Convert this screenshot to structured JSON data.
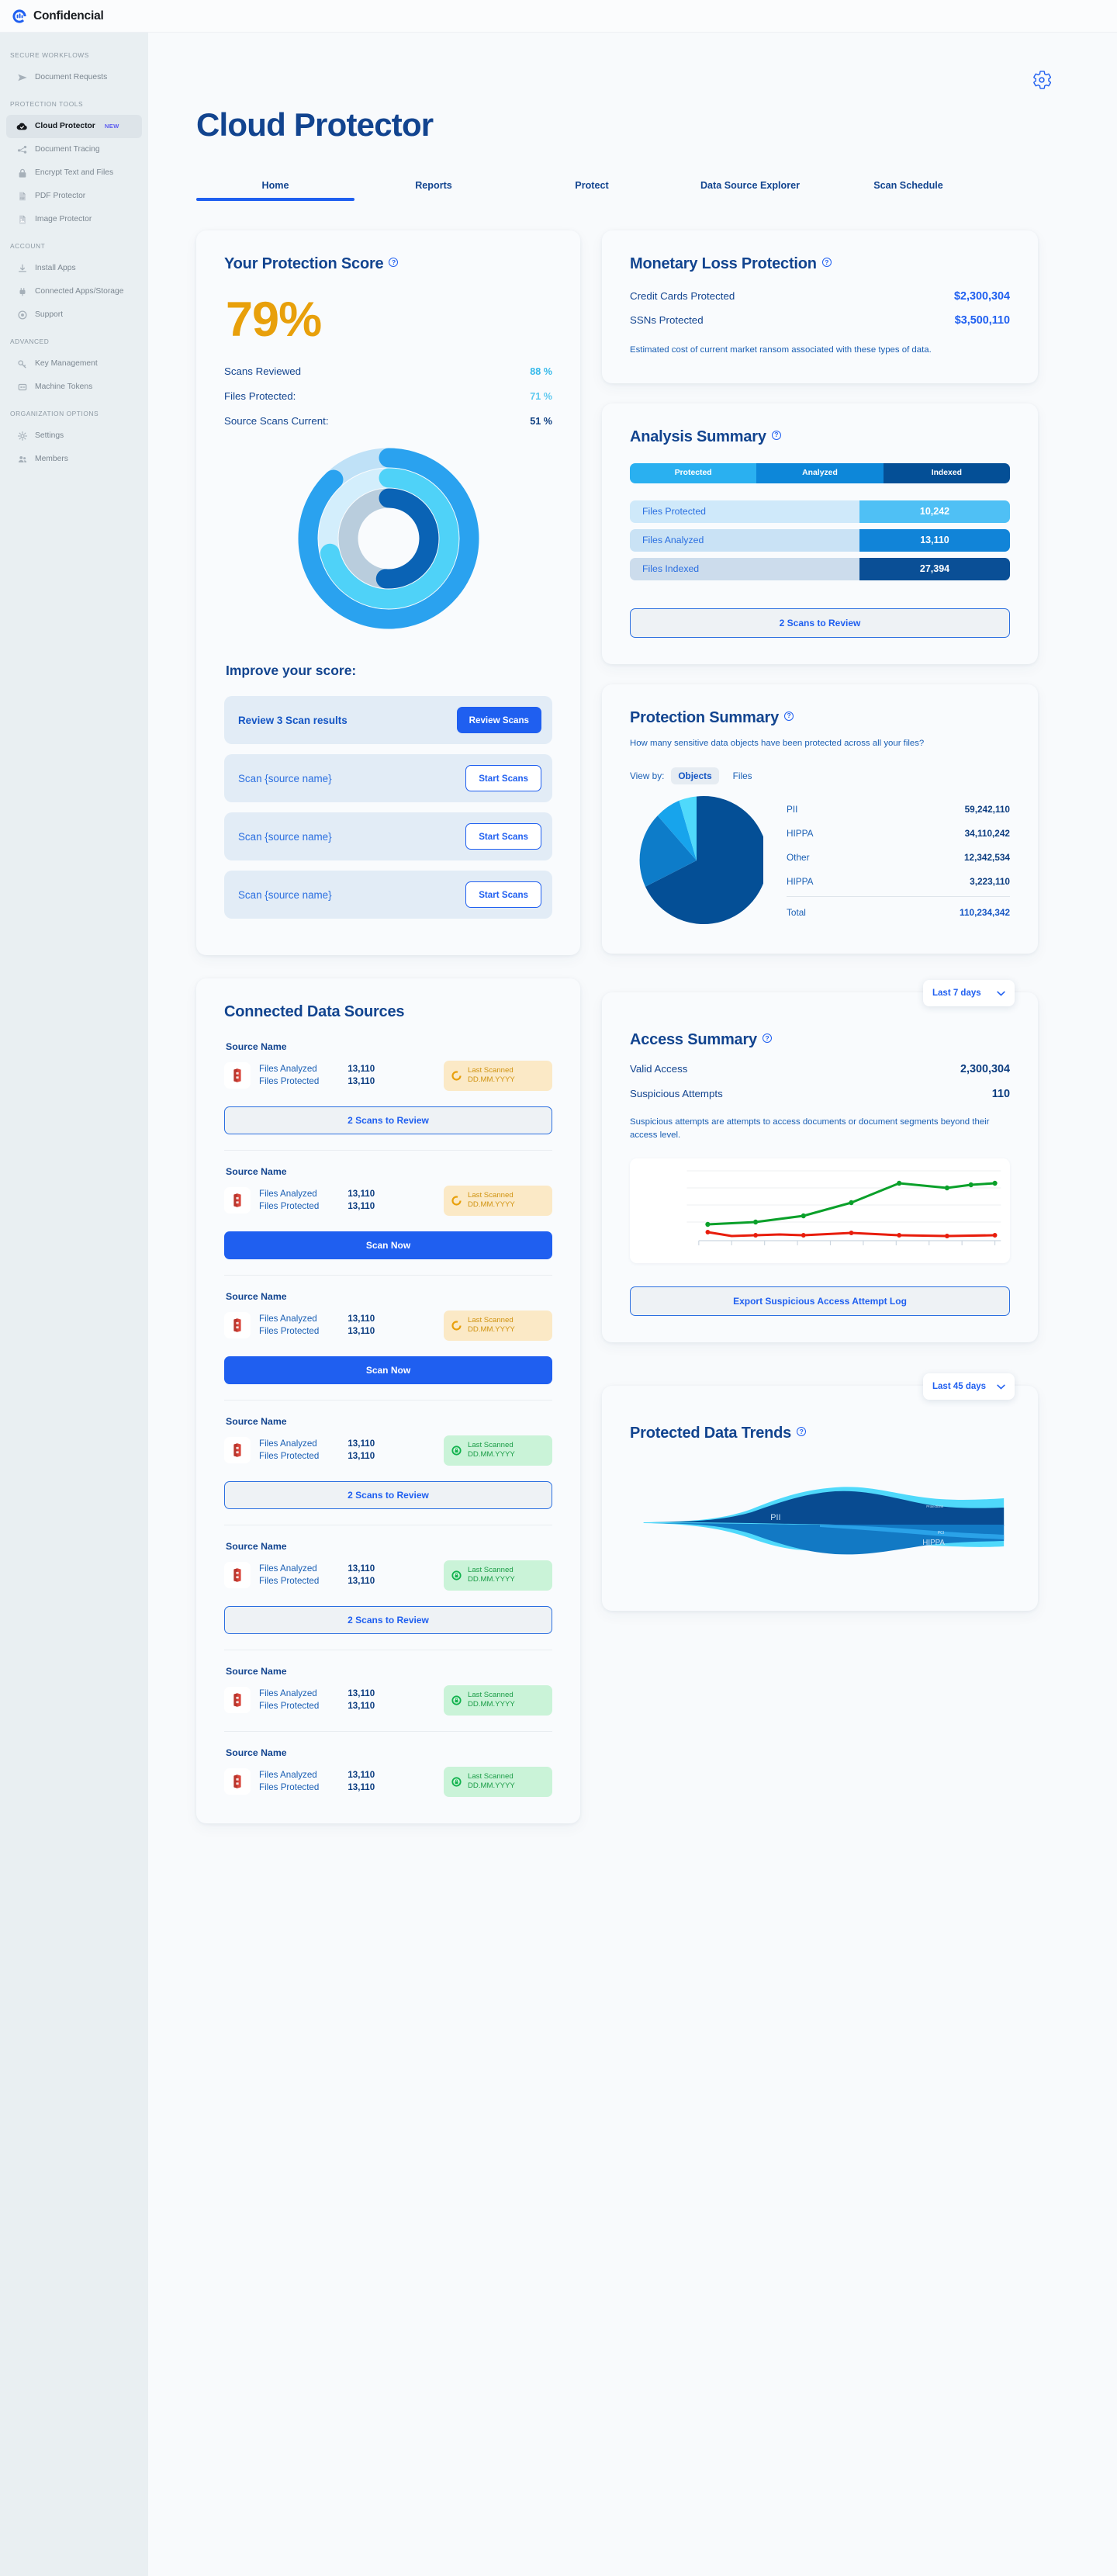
{
  "brand": {
    "name": "Confidencial",
    "logo_icon": "confidencial-logo-icon"
  },
  "sidebar": {
    "groups": [
      {
        "title": "SECURE WORKFLOWS",
        "items": [
          {
            "label": "Document Requests",
            "icon": "send-icon",
            "active": false
          }
        ]
      },
      {
        "title": "PROTECTION TOOLS",
        "items": [
          {
            "label": "Cloud Protector",
            "icon": "cloud-check-icon",
            "active": true,
            "badge": "NEW"
          },
          {
            "label": "Document Tracing",
            "icon": "network-icon",
            "active": false
          },
          {
            "label": "Encrypt Text and Files",
            "icon": "lock-icon",
            "active": false
          },
          {
            "label": "PDF Protector",
            "icon": "pdf-file-icon",
            "active": false
          },
          {
            "label": "Image Protector",
            "icon": "image-file-icon",
            "active": false
          }
        ]
      },
      {
        "title": "ACCOUNT",
        "items": [
          {
            "label": "Install Apps",
            "icon": "download-icon",
            "active": false
          },
          {
            "label": "Connected Apps/Storage",
            "icon": "plug-icon",
            "active": false
          },
          {
            "label": "Support",
            "icon": "lifebuoy-icon",
            "active": false
          }
        ]
      },
      {
        "title": "ADVANCED",
        "items": [
          {
            "label": "Key Management",
            "icon": "key-icon",
            "active": false
          },
          {
            "label": "Machine Tokens",
            "icon": "token-icon",
            "active": false
          }
        ]
      },
      {
        "title": "ORGANIZATION OPTIONS",
        "items": [
          {
            "label": "Settings",
            "icon": "gear-icon",
            "active": false
          },
          {
            "label": "Members",
            "icon": "people-icon",
            "active": false
          }
        ]
      }
    ]
  },
  "header": {
    "title": "Cloud Protector",
    "settings_icon": "gear-icon"
  },
  "tabs": [
    {
      "label": "Home",
      "active": true
    },
    {
      "label": "Reports",
      "active": false
    },
    {
      "label": "Protect",
      "active": false
    },
    {
      "label": "Data Source Explorer",
      "active": false
    },
    {
      "label": "Scan Schedule",
      "active": false
    }
  ],
  "protection_score": {
    "title": "Your Protection Score",
    "score": "79%",
    "metrics": [
      {
        "label": "Scans Reviewed",
        "value": "88 %"
      },
      {
        "label": "Files Protected:",
        "value": "71 %"
      },
      {
        "label": "Source Scans Current:",
        "value": "51 %"
      }
    ],
    "improve_heading": "Improve your score:",
    "improve_rows": [
      {
        "text": "Review 3 Scan results",
        "button": "Review Scans",
        "style": "primary"
      },
      {
        "text": "Scan {source name}",
        "button": "Start Scans",
        "style": "outline"
      },
      {
        "text": "Scan {source name}",
        "button": "Start Scans",
        "style": "outline"
      },
      {
        "text": "Scan {source name}",
        "button": "Start Scans",
        "style": "outline"
      }
    ]
  },
  "connected_sources": {
    "title": "Connected Data Sources",
    "label_analyzed": "Files Analyzed",
    "label_protected": "Files Protected",
    "sources": [
      {
        "name": "Source Name",
        "analyzed": "13,110",
        "protected": "13,110",
        "status": "warn",
        "status_top": "Last Scanned",
        "status_bottom": "DD.MM.YYYY",
        "action": "2 Scans to Review",
        "action_style": "review"
      },
      {
        "name": "Source Name",
        "analyzed": "13,110",
        "protected": "13,110",
        "status": "warn",
        "status_top": "Last Scanned",
        "status_bottom": "DD.MM.YYYY",
        "action": "Scan Now",
        "action_style": "scan"
      },
      {
        "name": "Source Name",
        "analyzed": "13,110",
        "protected": "13,110",
        "status": "warn",
        "status_top": "Last Scanned",
        "status_bottom": "DD.MM.YYYY",
        "action": "Scan Now",
        "action_style": "scan"
      },
      {
        "name": "Source Name",
        "analyzed": "13,110",
        "protected": "13,110",
        "status": "ok",
        "status_top": "Last Scanned",
        "status_bottom": "DD.MM.YYYY",
        "action": "2 Scans to Review",
        "action_style": "review"
      },
      {
        "name": "Source Name",
        "analyzed": "13,110",
        "protected": "13,110",
        "status": "ok",
        "status_top": "Last Scanned",
        "status_bottom": "DD.MM.YYYY",
        "action": "2 Scans to Review",
        "action_style": "review"
      },
      {
        "name": "Source Name",
        "analyzed": "13,110",
        "protected": "13,110",
        "status": "ok",
        "status_top": "Last Scanned",
        "status_bottom": "DD.MM.YYYY",
        "action": null,
        "action_style": null
      },
      {
        "name": "Source Name",
        "analyzed": "13,110",
        "protected": "13,110",
        "status": "ok",
        "status_top": "Last Scanned",
        "status_bottom": "DD.MM.YYYY",
        "action": null,
        "action_style": null
      }
    ]
  },
  "monetary": {
    "title": "Monetary Loss Protection",
    "rows": [
      {
        "label": "Credit Cards Protected",
        "value": "$2,300,304"
      },
      {
        "label": "SSNs Protected",
        "value": "$3,500,110"
      }
    ],
    "note": "Estimated cost of current market ransom associated with these types of data."
  },
  "analysis": {
    "title": "Analysis Summary",
    "segments": [
      {
        "label": "Protected",
        "color": "#2ab0f0"
      },
      {
        "label": "Analyzed",
        "color": "#0d87d9"
      },
      {
        "label": "Indexed",
        "color": "#044f96"
      }
    ],
    "rows": [
      {
        "label": "Files Protected",
        "value": "10,242",
        "bg": "#cfe9fa",
        "fill": "#4fc0f5"
      },
      {
        "label": "Files Analyzed",
        "value": "13,110",
        "bg": "#c9e2f5",
        "fill": "#1184d8"
      },
      {
        "label": "Files Indexed",
        "value": "27,394",
        "bg": "#ccdcec",
        "fill": "#0a4f96"
      }
    ],
    "action": "2 Scans to Review"
  },
  "protection_summary": {
    "title": "Protection Summary",
    "subtitle": "How many sensitive data objects have been protected across all your files?",
    "view_by_label": "View by:",
    "view_options": [
      {
        "label": "Objects",
        "selected": true
      },
      {
        "label": "Files",
        "selected": false
      }
    ],
    "total_label": "Total",
    "total_value": "110,234,342",
    "chart_data": {
      "type": "pie",
      "title": "Protection Summary",
      "categories": [
        "PII",
        "HIPPA",
        "Other",
        "HIPPA"
      ],
      "values": [
        59242110,
        34110242,
        12342534,
        3223110
      ],
      "value_labels": [
        "59,242,110",
        "34,110,242",
        "12,342,534",
        "3,223,110"
      ],
      "colors": [
        "#044f96",
        "#0d7cc9",
        "#17a4ec",
        "#4fd9fb"
      ],
      "legend": "right",
      "total": 110234342,
      "total_label": "110,234,342"
    }
  },
  "access_summary": {
    "title": "Access Summary",
    "range": "Last 7 days",
    "rows": [
      {
        "label": "Valid Access",
        "value": "2,300,304"
      },
      {
        "label": "Suspicious Attempts",
        "value": "110"
      }
    ],
    "note": "Suspicious attempts are attempts to access documents or document segments beyond their access level.",
    "export_button": "Export Suspicious Access Attempt Log",
    "chart_data": {
      "type": "line",
      "title": "Access Summary",
      "xlabel": "",
      "ylabel": "",
      "grid": true,
      "legend": "none",
      "x": [
        1,
        2,
        3,
        4,
        5,
        6,
        7,
        8,
        9,
        10
      ],
      "series": [
        {
          "name": "Valid Access",
          "color": "#0aa02a",
          "values": [
            18,
            22,
            30,
            38,
            52,
            76,
            70,
            73,
            69,
            76
          ]
        },
        {
          "name": "Suspicious Attempts",
          "color": "#e81d0c",
          "values": [
            11,
            5,
            6,
            7,
            6,
            9,
            8,
            7,
            6,
            7
          ]
        }
      ],
      "ylim": [
        0,
        100
      ]
    }
  },
  "data_trends": {
    "title": "Protected Data Trends",
    "range": "Last 45 days",
    "chart_data": {
      "type": "area",
      "title": "Protected Data Trends",
      "layout": "streamgraph",
      "labels": [
        "PII",
        "HIPPA",
        "PCI",
        "Protections"
      ],
      "series": [
        {
          "name": "PII",
          "color": "#084b91",
          "values": [
            1,
            1,
            2,
            2,
            3,
            4,
            6,
            10,
            18,
            28,
            38,
            46,
            52,
            55,
            57,
            58,
            58,
            57,
            55,
            52,
            48,
            44,
            40,
            36,
            32,
            28,
            24,
            21,
            18,
            16,
            14,
            13,
            12,
            12,
            11,
            11,
            11,
            11,
            11,
            11,
            11,
            11,
            11,
            11,
            11
          ]
        },
        {
          "name": "HIPPA",
          "color": "#1279c4",
          "values": [
            1,
            1,
            1,
            2,
            2,
            3,
            5,
            8,
            13,
            20,
            27,
            33,
            38,
            42,
            45,
            47,
            48,
            49,
            50,
            51,
            52,
            53,
            54,
            55,
            56,
            57,
            58,
            59,
            60,
            60,
            61,
            61,
            62,
            62,
            62,
            62,
            62,
            62,
            62,
            62,
            62,
            62,
            62,
            62,
            62
          ]
        },
        {
          "name": "PCI",
          "color": "#2aa2e8",
          "values": [
            0,
            0,
            0,
            0,
            1,
            1,
            1,
            2,
            3,
            4,
            5,
            5,
            6,
            6,
            6,
            6,
            6,
            6,
            6,
            6,
            6,
            6,
            6,
            6,
            6,
            6,
            6,
            6,
            6,
            6,
            6,
            6,
            6,
            6,
            6,
            6,
            6,
            6,
            6,
            6,
            6,
            6,
            6,
            6,
            6
          ]
        },
        {
          "name": "Protections",
          "color": "#4fd9fb",
          "values": [
            0,
            0,
            0,
            1,
            1,
            2,
            3,
            5,
            7,
            9,
            11,
            12,
            13,
            13,
            13,
            13,
            13,
            13,
            13,
            13,
            12,
            12,
            12,
            12,
            12,
            12,
            12,
            12,
            12,
            11,
            11,
            11,
            11,
            11,
            11,
            11,
            11,
            11,
            11,
            11,
            11,
            11,
            11,
            11,
            11
          ]
        }
      ]
    }
  }
}
